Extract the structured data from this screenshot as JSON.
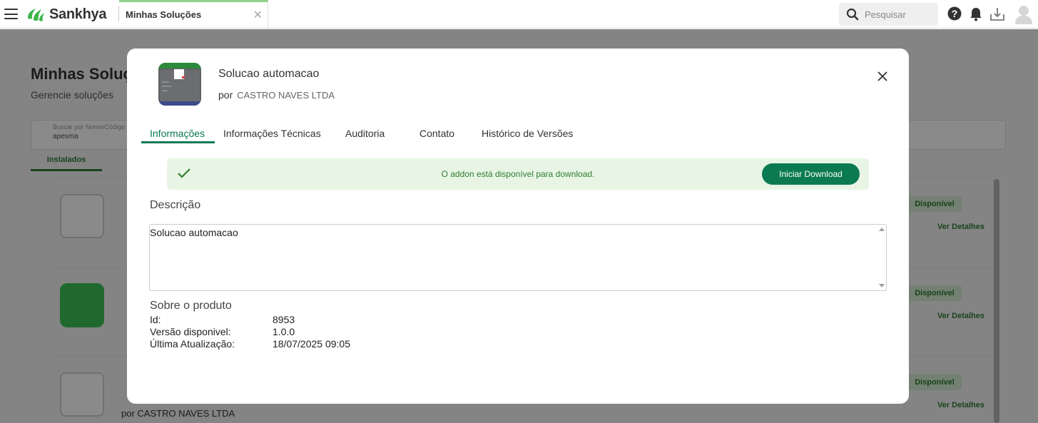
{
  "header": {
    "brand": "Sankhya",
    "active_tab": "Minhas Soluções",
    "search_placeholder": "Pesquisar"
  },
  "background": {
    "page_title": "Minhas Soluções",
    "page_subtitle": "Gerencie soluções",
    "filter_label": "Buscar por Nome/Código",
    "filter_value": "apesma",
    "tab": "Instalados",
    "cards": [
      {
        "status": "Disponível",
        "link": "Ver Detalhes"
      },
      {
        "status": "Disponível",
        "link": "Ver Detalhes"
      },
      {
        "status": "Disponível",
        "link": "Ver Detalhes",
        "vendor": "por CASTRO NAVES LTDA"
      }
    ]
  },
  "modal": {
    "title": "Solucao automacao",
    "by_prefix": "por",
    "vendor": "CASTRO NAVES LTDA",
    "tabs": [
      {
        "label": "Informações",
        "active": true
      },
      {
        "label": "Informações Técnicas",
        "active": false
      },
      {
        "label": "Auditoria",
        "active": false
      },
      {
        "label": "Contato",
        "active": false
      },
      {
        "label": "Histórico de Versões",
        "active": false
      }
    ],
    "notice": {
      "text": "O addon está disponível para download.",
      "button": "Iniciar Download"
    },
    "description_label": "Descrição",
    "description": "Solucao automacao",
    "about": {
      "title": "Sobre o produto",
      "rows": [
        {
          "key": "Id:",
          "value": "8953"
        },
        {
          "key": "Versão disponivel:",
          "value": "1.0.0"
        },
        {
          "key": "Última Atualização:",
          "value": "18/07/2025 09:05"
        }
      ]
    }
  },
  "colors": {
    "accent": "#0b7a52",
    "notice_bg": "#e8f5e4",
    "notice_text": "#2e7d32",
    "tab_indicator": "#8fd18b"
  }
}
